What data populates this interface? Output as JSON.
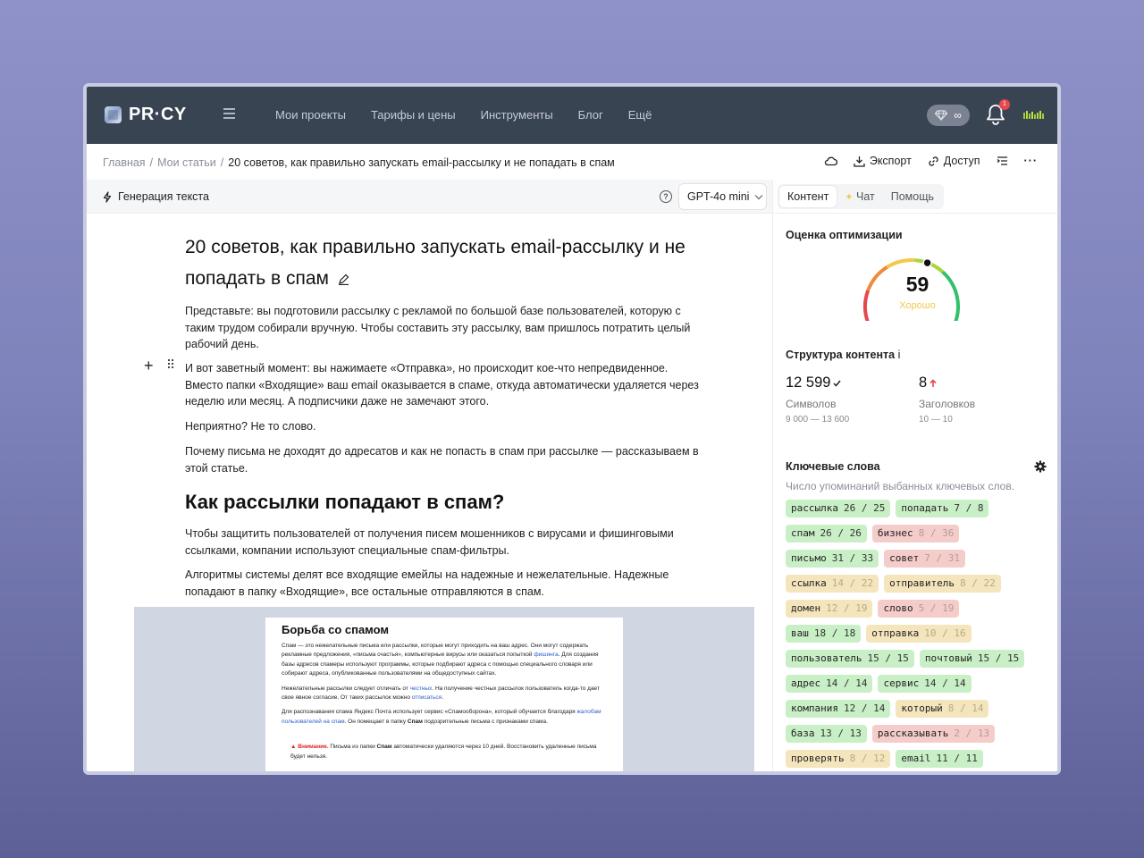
{
  "header": {
    "logo": "PR·CY",
    "nav": [
      "Мои проекты",
      "Тарифы и цены",
      "Инструменты",
      "Блог",
      "Ещё"
    ],
    "plan_value": "∞",
    "notifications_count": "1"
  },
  "breadcrumb": {
    "items": [
      "Главная",
      "Мои статьи"
    ],
    "current": "20 советов, как правильно запускать email-рассылку и не попадать в спам"
  },
  "toolbar": {
    "export_label": "Экспорт",
    "access_label": "Доступ",
    "more_label": "···"
  },
  "editor": {
    "generate_label": "Генерация текста",
    "model": "GPT-4o mini",
    "help": "?"
  },
  "tabs": {
    "content": "Контент",
    "chat": "Чат",
    "help": "Помощь"
  },
  "article": {
    "title": "20 советов, как правильно запускать email-рассылку и не попадать в спам",
    "paragraphs": [
      "Представьте: вы подготовили рассылку с рекламой по большой базе пользователей, которую с таким трудом собирали вручную. Чтобы составить эту рассылку, вам пришлось потратить целый рабочий день.",
      "И вот заветный момент: вы нажимаете «Отправка», но происходит кое-что непредвиденное. Вместо папки «Входящие» ваш email оказывается в спаме, откуда автоматически удаляется через неделю или месяц. А подписчики даже не замечают этого.",
      "Неприятно? Не то слово.",
      "Почему письма не доходят до адресатов и как не попасть в спам при рассылке — рассказываем в этой статье."
    ],
    "h2": "Как рассылки попадают в спам?",
    "paragraphs2": [
      "Чтобы защитить пользователей от получения писем мошенников с вирусами и фишинговыми ссылками, компании используют специальные спам-фильтры.",
      "Алгоритмы системы делят все входящие емейлы на надежные и нежелательные. Надежные попадают в папку «Входящие», все остальные отправляются в спам."
    ],
    "figure": {
      "title": "Борьба со спамом",
      "p1_a": "Спам — это нежелательные письма или рассылки, которые могут приходить на ваш адрес. Они могут содержать рекламные предложения, «письма счастья», компьютерные вирусы или оказаться попыткой ",
      "p1_link": "фишинга",
      "p1_b": ". Для создания базы адресов спамеры используют программы, которые подбирают адреса с помощью специального словаря или собирают адреса, опубликованные пользователями на общедоступных сайтах.",
      "p2_a": "Нежелательные рассылки следует отличать от ",
      "p2_link": "честных",
      "p2_b": ". На получение честных рассылок пользователь когда-то дает свое явное согласие. От таких рассылок можно ",
      "p2_link2": "отписаться",
      "p2_c": ".",
      "p3_a": "Для распознавания спама Яндекс Почта использует сервис «Спамооборона», который обучается благодаря ",
      "p3_link": "жалобам пользователей на спам",
      "p3_b": ". Он помещает в папку ",
      "p3_bold": "Спам",
      "p3_c": " подозрительные письма с признаками спама.",
      "warn_label": "Внимание.",
      "warn_a": " Письма из папки ",
      "warn_bold": "Спам",
      "warn_b": " автоматически удаляются через 10 дней. Восстановить удаленные письма будет нельзя."
    }
  },
  "panel": {
    "optimization_title": "Оценка оптимизации",
    "score": "59",
    "score_fraction": 0.59,
    "score_label": "Хорошо",
    "structure_title": "Структура контента",
    "structure_info": "i",
    "chars_value": "12 599",
    "chars_label": "Символов",
    "chars_range": "9 000 — 13 600",
    "headings_value": "8",
    "headings_label": "Заголовков",
    "headings_range": "10 — 10",
    "keywords_title": "Ключевые слова",
    "keywords_sub": "Число упоминаний выбанных ключевых слов.",
    "keywords": [
      [
        {
          "word": "рассылка",
          "count": "26 / 25",
          "status": "green"
        },
        {
          "word": "попадать",
          "count": "7 / 8",
          "status": "green"
        }
      ],
      [
        {
          "word": "спам",
          "count": "26 / 26",
          "status": "green"
        },
        {
          "word": "бизнес",
          "count": "8 / 36",
          "status": "red"
        }
      ],
      [
        {
          "word": "письмо",
          "count": "31 / 33",
          "status": "green"
        },
        {
          "word": "совет",
          "count": "7 / 31",
          "status": "red"
        }
      ],
      [
        {
          "word": "ссылка",
          "count": "14 / 22",
          "status": "yellow"
        },
        {
          "word": "отправитель",
          "count": "8 / 22",
          "status": "yellow"
        }
      ],
      [
        {
          "word": "домен",
          "count": "12 / 19",
          "status": "yellow"
        },
        {
          "word": "слово",
          "count": "5 / 19",
          "status": "red"
        }
      ],
      [
        {
          "word": "ваш",
          "count": "18 / 18",
          "status": "green"
        },
        {
          "word": "отправка",
          "count": "10 / 16",
          "status": "yellow"
        }
      ],
      [
        {
          "word": "пользователь",
          "count": "15 / 15",
          "status": "green"
        },
        {
          "word": "почтовый",
          "count": "15 / 15",
          "status": "green"
        }
      ],
      [
        {
          "word": "адрес",
          "count": "14 / 14",
          "status": "green"
        },
        {
          "word": "сервис",
          "count": "14 / 14",
          "status": "green"
        }
      ],
      [
        {
          "word": "компания",
          "count": "12 / 14",
          "status": "green"
        },
        {
          "word": "который",
          "count": "8 / 14",
          "status": "yellow"
        }
      ],
      [
        {
          "word": "база",
          "count": "13 / 13",
          "status": "green"
        },
        {
          "word": "рассказывать",
          "count": "2 / 13",
          "status": "red"
        }
      ],
      [
        {
          "word": "проверять",
          "count": "8 / 12",
          "status": "yellow"
        },
        {
          "word": "email",
          "count": "11 / 11",
          "status": "green"
        }
      ]
    ]
  },
  "colors": {
    "header_bg": "#394453",
    "chip_green": "#c9efc6",
    "chip_red": "#f4cdcb",
    "chip_yellow": "#f5e5bd",
    "score_label": "#f0c94b"
  }
}
